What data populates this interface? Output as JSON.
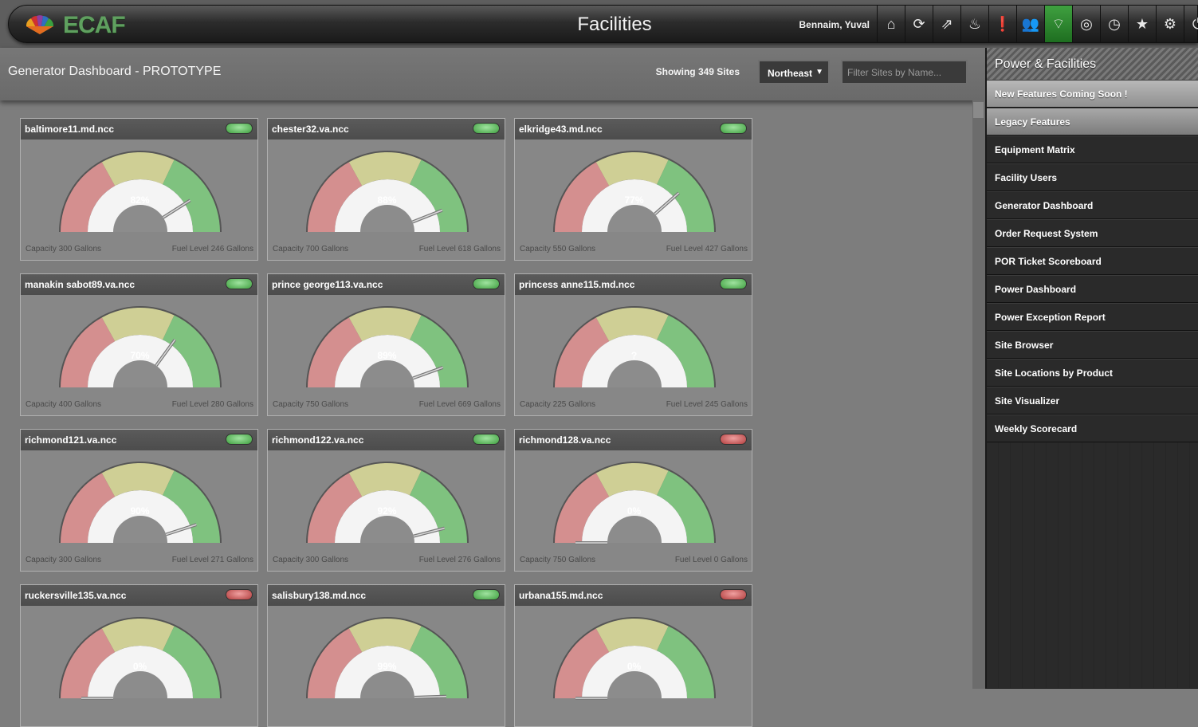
{
  "header": {
    "logo_text": "ECAF",
    "app_title": "Facilities",
    "user_name": "Bennaim, Yuval",
    "toolbar_icons": [
      "home-icon",
      "refresh-icon",
      "share-icon",
      "fire-icon",
      "alert-icon",
      "users-icon",
      "wifi-icon",
      "fingerprint-icon",
      "clock-icon",
      "star-icon",
      "gear-icon",
      "power-icon"
    ],
    "active_icon": "wifi-icon"
  },
  "subheader": {
    "title": "Generator Dashboard - PROTOTYPE",
    "site_count": "Showing 349 Sites",
    "region": "Northeast",
    "filter_placeholder": "Filter Sites by Name..."
  },
  "sites": [
    {
      "name": "baltimore11.md.ncc",
      "status": "green",
      "percent": "82%",
      "fill": 0.82,
      "capacity": "Capacity 300 Gallons",
      "fuel": "Fuel Level 246 Gallons"
    },
    {
      "name": "chester32.va.ncc",
      "status": "green",
      "percent": "88%",
      "fill": 0.88,
      "capacity": "Capacity 700 Gallons",
      "fuel": "Fuel Level 618 Gallons"
    },
    {
      "name": "elkridge43.md.ncc",
      "status": "green",
      "percent": "77%",
      "fill": 0.77,
      "capacity": "Capacity 550 Gallons",
      "fuel": "Fuel Level 427 Gallons"
    },
    {
      "name": "manakin sabot89.va.ncc",
      "status": "green",
      "percent": "70%",
      "fill": 0.7,
      "capacity": "Capacity 400 Gallons",
      "fuel": "Fuel Level 280 Gallons"
    },
    {
      "name": "prince george113.va.ncc",
      "status": "green",
      "percent": "89%",
      "fill": 0.89,
      "capacity": "Capacity 750 Gallons",
      "fuel": "Fuel Level 669 Gallons"
    },
    {
      "name": "princess anne115.md.ncc",
      "status": "green",
      "percent": "?",
      "fill": null,
      "capacity": "Capacity 225 Gallons",
      "fuel": "Fuel Level 245 Gallons"
    },
    {
      "name": "richmond121.va.ncc",
      "status": "green",
      "percent": "90%",
      "fill": 0.9,
      "capacity": "Capacity 300 Gallons",
      "fuel": "Fuel Level 271 Gallons"
    },
    {
      "name": "richmond122.va.ncc",
      "status": "green",
      "percent": "92%",
      "fill": 0.92,
      "capacity": "Capacity 300 Gallons",
      "fuel": "Fuel Level 276 Gallons"
    },
    {
      "name": "richmond128.va.ncc",
      "status": "red",
      "percent": "0%",
      "fill": 0.0,
      "capacity": "Capacity 750 Gallons",
      "fuel": "Fuel Level 0 Gallons"
    },
    {
      "name": "ruckersville135.va.ncc",
      "status": "red",
      "percent": "0%",
      "fill": 0.0,
      "capacity": "",
      "fuel": ""
    },
    {
      "name": "salisbury138.md.ncc",
      "status": "green",
      "percent": "99%",
      "fill": 0.99,
      "capacity": "",
      "fuel": ""
    },
    {
      "name": "urbana155.md.ncc",
      "status": "red",
      "percent": "0%",
      "fill": 0.0,
      "capacity": "",
      "fuel": ""
    }
  ],
  "sidebar": {
    "title": "Power & Facilities",
    "items": [
      {
        "label": "New Features Coming Soon !",
        "style": "light"
      },
      {
        "label": "Legacy Features",
        "style": "mid"
      },
      {
        "label": "Equipment Matrix",
        "style": "dark"
      },
      {
        "label": "Facility Users",
        "style": "dark"
      },
      {
        "label": "Generator Dashboard",
        "style": "dark"
      },
      {
        "label": "Order Request System",
        "style": "dark"
      },
      {
        "label": "POR Ticket Scoreboard",
        "style": "dark"
      },
      {
        "label": "Power Dashboard",
        "style": "dark"
      },
      {
        "label": "Power Exception Report",
        "style": "dark"
      },
      {
        "label": "Site Browser",
        "style": "dark"
      },
      {
        "label": "Site Locations by Product",
        "style": "dark"
      },
      {
        "label": "Site Visualizer",
        "style": "dark"
      },
      {
        "label": "Weekly Scorecard",
        "style": "dark"
      }
    ]
  },
  "colors": {
    "active_green": "#2f8f30",
    "led_green": "#5fbf5f",
    "led_red": "#c84848",
    "gauge_red": "#d48f8f",
    "gauge_yellow": "#cfcf95",
    "gauge_green": "#7fc27f"
  }
}
